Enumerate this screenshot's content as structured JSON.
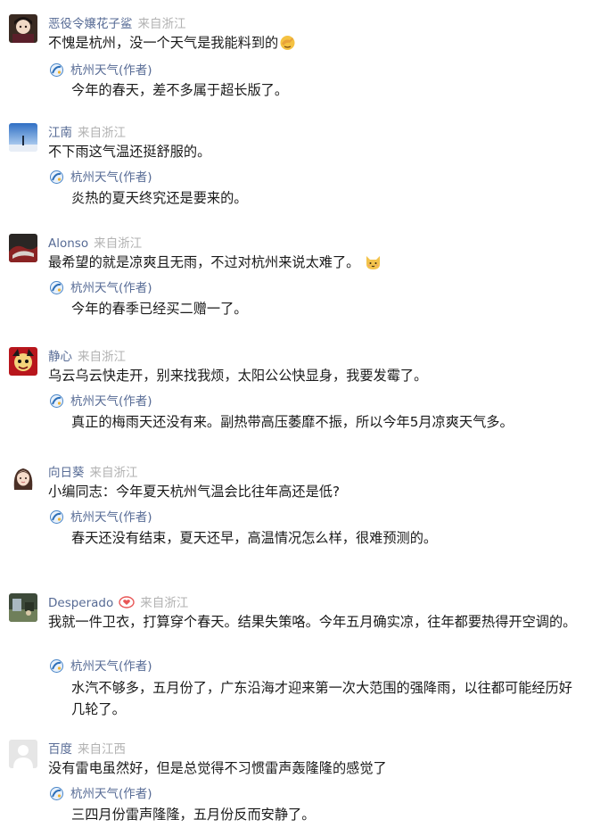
{
  "reply_author": "杭州天气",
  "reply_tag": "(作者)",
  "comments": [
    {
      "user": "恶役令嬢花子鲨",
      "location": "来自浙江",
      "text": "不愧是杭州，没一个天气是我能料到的",
      "emoji": "facepalm-emoji",
      "reply": "今年的春天，差不多属于超长版了。"
    },
    {
      "user": "江南",
      "location": "来自浙江",
      "text": "不下雨这气温还挺舒服的。",
      "reply": "炎热的夏天终究还是要来的。"
    },
    {
      "user": "Alonso",
      "location": "来自浙江",
      "text": "最希望的就是凉爽且无雨，不过对杭州来说太难了。",
      "emoji": "cat-emoji",
      "reply": "今年的春季已经买二赠一了。"
    },
    {
      "user": "静心",
      "location": "来自浙江",
      "text": "乌云乌云快走开，别来找我烦，太阳公公快显身，我要发霉了。",
      "reply": "真正的梅雨天还没有来。副热带高压萎靡不振，所以今年5月凉爽天气多。"
    },
    {
      "user": "向日葵",
      "location": "来自浙江",
      "text": "小编同志：今年夏天杭州气温会比往年高还是低?",
      "reply": "春天还没有结束，夏天还早，高温情况怎么样，很难预测的。"
    },
    {
      "user": "Desperado",
      "location": "来自浙江",
      "badge": "heart-badge-icon",
      "text": "我就一件卫衣，打算穿个春天。结果失策咯。今年五月确实凉，往年都要热得开空调的。",
      "reply": "水汽不够多，五月份了，广东沿海才迎来第一次大范围的强降雨，以往都可能经历好几轮了。"
    },
    {
      "user": "百度",
      "location": "来自江西",
      "text": "没有雷电虽然好，但是总觉得不习惯雷声轰隆隆的感觉了",
      "reply": "三四月份雷声隆隆，五月份反而安静了。"
    }
  ]
}
